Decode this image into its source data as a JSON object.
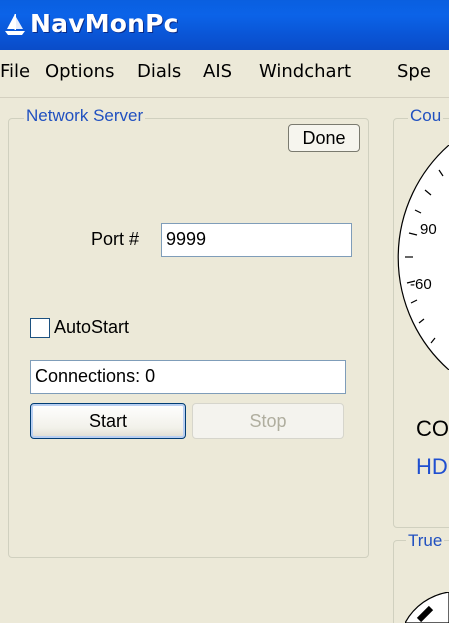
{
  "window": {
    "title": "NavMonPc"
  },
  "menu": {
    "items": [
      "File",
      "Options",
      "Dials",
      "AIS",
      "Windchart",
      "Spe"
    ]
  },
  "network_server": {
    "group_label": "Network Server",
    "done_label": "Done",
    "port_label": "Port #",
    "port_value": "9999",
    "autostart_label": "AutoStart",
    "autostart_checked": false,
    "connections_text": "Connections: 0",
    "start_label": "Start",
    "stop_label": "Stop"
  },
  "course_panel": {
    "group_label": "Cou",
    "dial_tick_90": "90",
    "dial_tick_60": "-60",
    "co_label": "CO",
    "hd_label": "HD"
  },
  "true_panel": {
    "group_label": "True"
  },
  "colors": {
    "titlebar": "#0a5fe0",
    "group_label": "#2050c0",
    "hd_label": "#1f4fd0"
  }
}
